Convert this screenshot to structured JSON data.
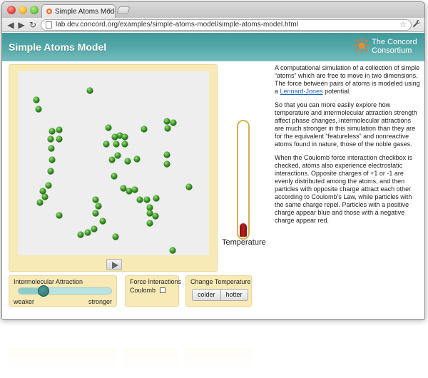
{
  "browser": {
    "tab_title": "Simple Atoms Model",
    "tab_close": "×",
    "url": "lab.dev.concord.org/examples/simple-atoms-model/simple-atoms-model.html",
    "back_glyph": "◀",
    "forward_glyph": "▶",
    "reload_glyph": "↻",
    "star_glyph": "☆",
    "wrench_glyph": "🔧"
  },
  "page": {
    "title": "Simple Atoms Model",
    "logo": {
      "line1": "The Concord",
      "line2": "Consortium"
    }
  },
  "description": {
    "p1_before": "A computational simulation of a collection of simple “atoms” which are free to move in two dimensions. The force between pairs of atoms is modeled using a ",
    "p1_link": "Lennard-Jones",
    "p1_after": " potential.",
    "p2": "So that you can more easily explore how temperature and intermolecular attraction strength affect phase changes, intermolecular attractions are much stronger in this simulation than they are for the equivalent “featureless” and nonreactive atoms found in nature, those of the noble gases.",
    "p3": "When the Coulomb force interaction checkbox is checked, atoms also experience electrostatic interactions. Opposite charges of +1 or -1 are evenly distributed among the atoms, and then particles with opposite charge attract each other according to Coulomb’s Law, while particles with the same charge repel. Particles with a positive charge appear blue and those with a negative charge appear red."
  },
  "thermometer": {
    "label": "Temperature",
    "level": 0.12
  },
  "controls": {
    "attraction": {
      "title": "Intermolecular Attraction",
      "min_label": "weaker",
      "max_label": "stronger",
      "value": 0.27
    },
    "force": {
      "title": "Force Interactions",
      "coulomb_label": "Coulomb",
      "coulomb_checked": false
    },
    "temperature": {
      "title": "Change Temperature",
      "colder_label": "colder",
      "hotter_label": "hotter"
    }
  },
  "colors": {
    "header": "#57a9aa",
    "panel": "#f7eab6",
    "atom": "#3f9a2a",
    "thermometer_fill": "#c21f1f",
    "link": "#1f66b5"
  },
  "icons": {
    "close": "close-icon",
    "play": "play-icon",
    "star": "bookmark-star-icon",
    "wrench": "wrench-icon"
  }
}
